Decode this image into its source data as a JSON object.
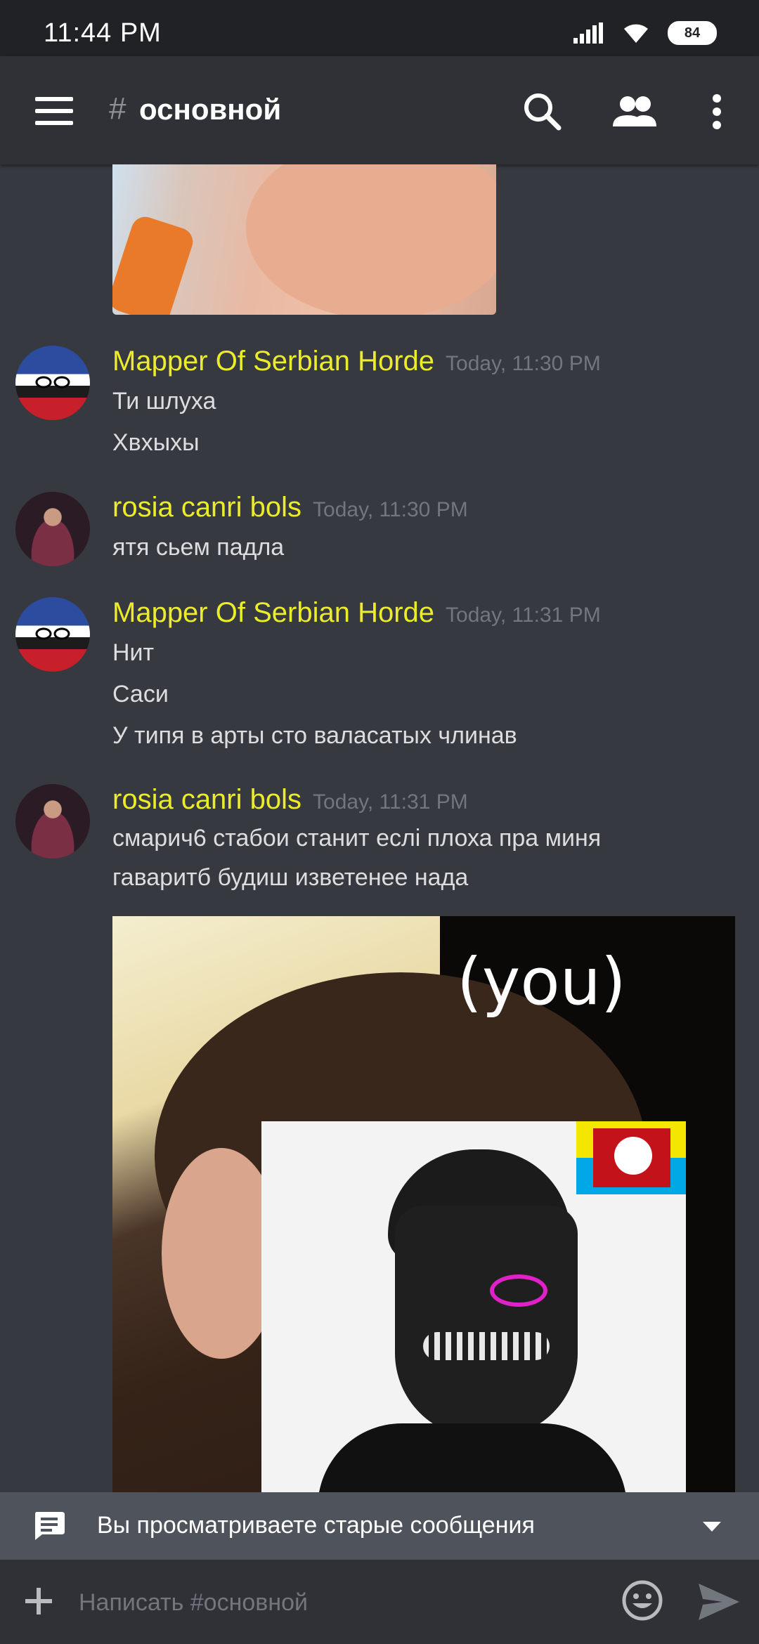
{
  "status_bar": {
    "time": "11:44 PM",
    "battery": "84",
    "icons": [
      "signal-icon",
      "wifi-icon",
      "battery-icon"
    ]
  },
  "header": {
    "hash": "#",
    "channel_name": "основной",
    "icons": [
      "menu-icon",
      "search-icon",
      "members-icon",
      "more-icon"
    ]
  },
  "messages": [
    {
      "author": "Mapper Of Serbian Horde",
      "timestamp": "Today, 11:30 PM",
      "lines": [
        "Ти шлуха",
        "Хвхыхы"
      ]
    },
    {
      "author": "rosia canri bols",
      "timestamp": "Today, 11:30 PM",
      "lines": [
        "ятя сьем падла"
      ]
    },
    {
      "author": "Mapper Of Serbian Horde",
      "timestamp": "Today, 11:31 PM",
      "lines": [
        "Нит",
        "Саси",
        "У типя в арты сто валасатых члинав"
      ]
    },
    {
      "author": "rosia canri bols",
      "timestamp": "Today, 11:31 PM",
      "lines": [
        "смарич6 стабои станит еслі плоха пра миня",
        "гаваритб будиш изветенее нада"
      ],
      "image_text": "(you)"
    }
  ],
  "banner": {
    "text": "Вы просматриваете старые сообщения",
    "icon": "message-icon"
  },
  "composer": {
    "placeholder": "Написать #основной",
    "value": ""
  },
  "colors": {
    "background": "#36393f",
    "header": "#2f3136",
    "author": "#ecec2a",
    "timestamp": "#72767d",
    "text": "#dcddde",
    "banner": "#4f545c"
  }
}
